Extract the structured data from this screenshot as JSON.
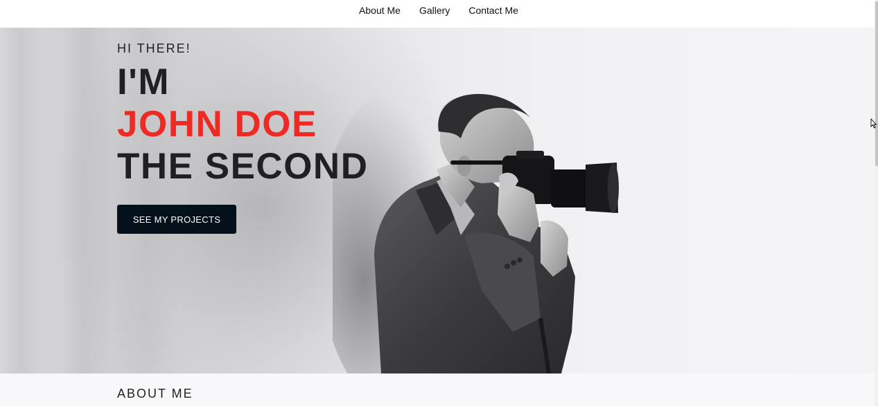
{
  "nav": {
    "items": [
      {
        "label": "About Me"
      },
      {
        "label": "Gallery"
      },
      {
        "label": "Contact Me"
      }
    ]
  },
  "hero": {
    "eyebrow": "HI THERE!",
    "line1": "I'M",
    "line2": "JOHN DOE",
    "line3": "THE SECOND",
    "cta_label": "SEE MY PROJECTS",
    "accent_color": "#ee2a24",
    "dark_color": "#1f2023",
    "button_color": "#05111a",
    "image": "photographer-with-camera"
  },
  "about": {
    "title": "ABOUT ME"
  }
}
